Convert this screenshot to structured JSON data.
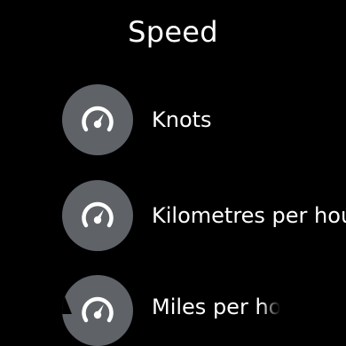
{
  "header": {
    "title": "Speed"
  },
  "list": {
    "items": [
      {
        "label": "Knots",
        "icon": "speedometer-icon"
      },
      {
        "label": "Kilometres per hour",
        "icon": "speedometer-icon"
      },
      {
        "label": "Miles per hour",
        "icon": "speedometer-icon"
      }
    ]
  },
  "colors": {
    "background": "#000000",
    "icon_circle": "#5f6368",
    "text": "#ffffff"
  }
}
